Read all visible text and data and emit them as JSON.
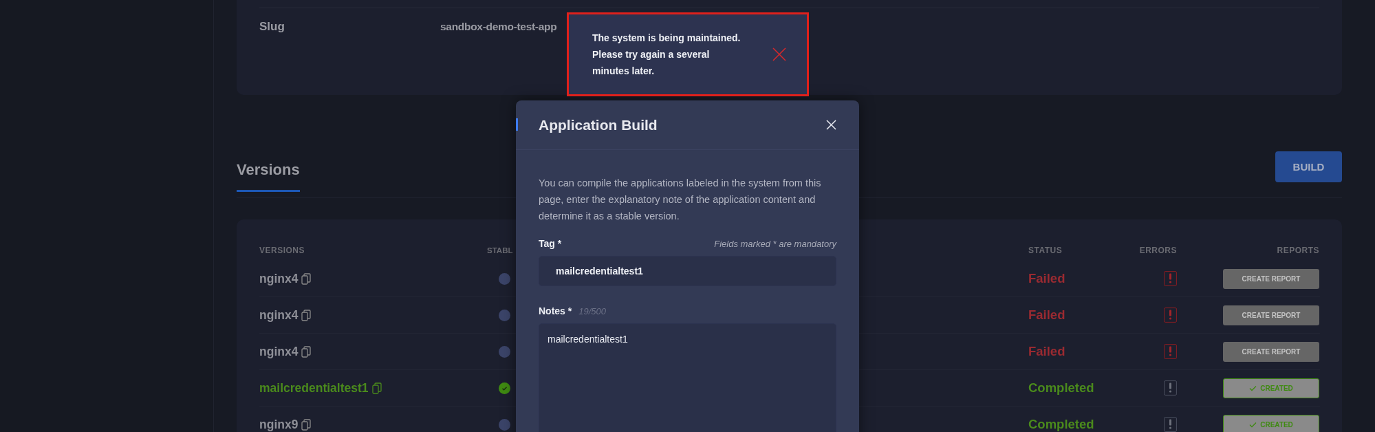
{
  "details": {
    "rows": [
      {
        "label": "Slug",
        "value": "sandbox-demo-test-app"
      }
    ]
  },
  "versions_section": {
    "tabs": [
      {
        "label": "Versions",
        "selected": true
      }
    ],
    "build_button": "BUILD"
  },
  "table": {
    "columns": [
      "VERSIONS",
      "STABL",
      "STATUS",
      "ERRORS",
      "REPORTS"
    ],
    "rows": [
      {
        "version": "nginx4",
        "stable": false,
        "status": {
          "kind": "failed",
          "text": "Failed"
        },
        "has_errors": true,
        "report": {
          "kind": "create",
          "label": "CREATE REPORT"
        }
      },
      {
        "version": "nginx4",
        "stable": false,
        "status": {
          "kind": "failed",
          "text": "Failed"
        },
        "has_errors": true,
        "report": {
          "kind": "create",
          "label": "CREATE REPORT"
        }
      },
      {
        "version": "nginx4",
        "stable": false,
        "status": {
          "kind": "failed",
          "text": "Failed"
        },
        "has_errors": true,
        "report": {
          "kind": "create",
          "label": "CREATE REPORT"
        }
      },
      {
        "version": "mailcredentialtest1",
        "stable": true,
        "status": {
          "kind": "completed",
          "text": "Completed"
        },
        "has_errors": false,
        "report": {
          "kind": "created",
          "label": "CREATED"
        }
      },
      {
        "version": "nginx9",
        "stable": false,
        "status": {
          "kind": "completed",
          "text": "Completed"
        },
        "has_errors": false,
        "report": {
          "kind": "created",
          "label": "CREATED"
        }
      }
    ]
  },
  "modal": {
    "title": "Application Build",
    "description": "You can compile the applications labeled in the system from this page, enter the explanatory note of the application content and determine it as a stable version.",
    "tag": {
      "label": "Tag *",
      "hint": "Fields marked * are mandatory",
      "value": "mailcredentialtest1"
    },
    "notes": {
      "label": "Notes *",
      "counter": "19/500",
      "value": "mailcredentialtest1"
    }
  },
  "toast": {
    "message": "The system is being maintained. Please try again a several minutes later."
  }
}
